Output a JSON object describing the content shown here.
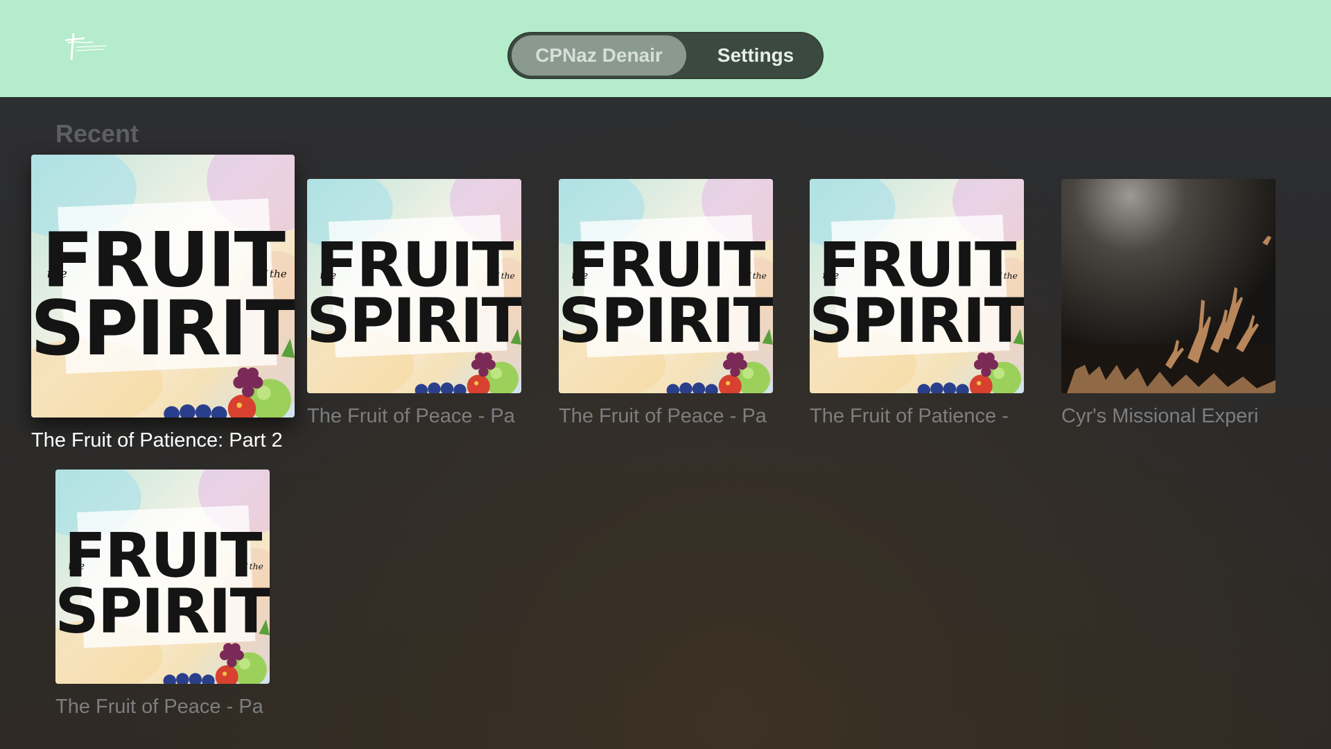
{
  "topbar": {
    "logo_name": "church-logo",
    "tabs": [
      {
        "label": "CPNaz Denair",
        "selected": true
      },
      {
        "label": "Settings",
        "selected": false
      }
    ],
    "background_color": "#b5eccb"
  },
  "recent": {
    "title": "Recent",
    "items": [
      {
        "caption": "The Fruit of Patience: Part 2",
        "art": "fruit-of-the-spirit",
        "focused": true
      },
      {
        "caption": "The Fruit of Peace - Pa",
        "art": "fruit-of-the-spirit",
        "focused": false
      },
      {
        "caption": "The Fruit of Peace - Pa",
        "art": "fruit-of-the-spirit",
        "focused": false
      },
      {
        "caption": "The Fruit of Patience -",
        "art": "fruit-of-the-spirit",
        "focused": false
      },
      {
        "caption": "Cyr's Missional Experi",
        "art": "worship-hands-photo",
        "focused": false
      },
      {
        "caption": "The Fruit of Peace - Pa",
        "art": "fruit-of-the-spirit",
        "focused": false
      }
    ]
  },
  "artwork": {
    "fruit_line1": "FRUIT",
    "fruit_line2": "SPIRIT",
    "fruit_small_left": "the",
    "fruit_small_right": "of the"
  }
}
